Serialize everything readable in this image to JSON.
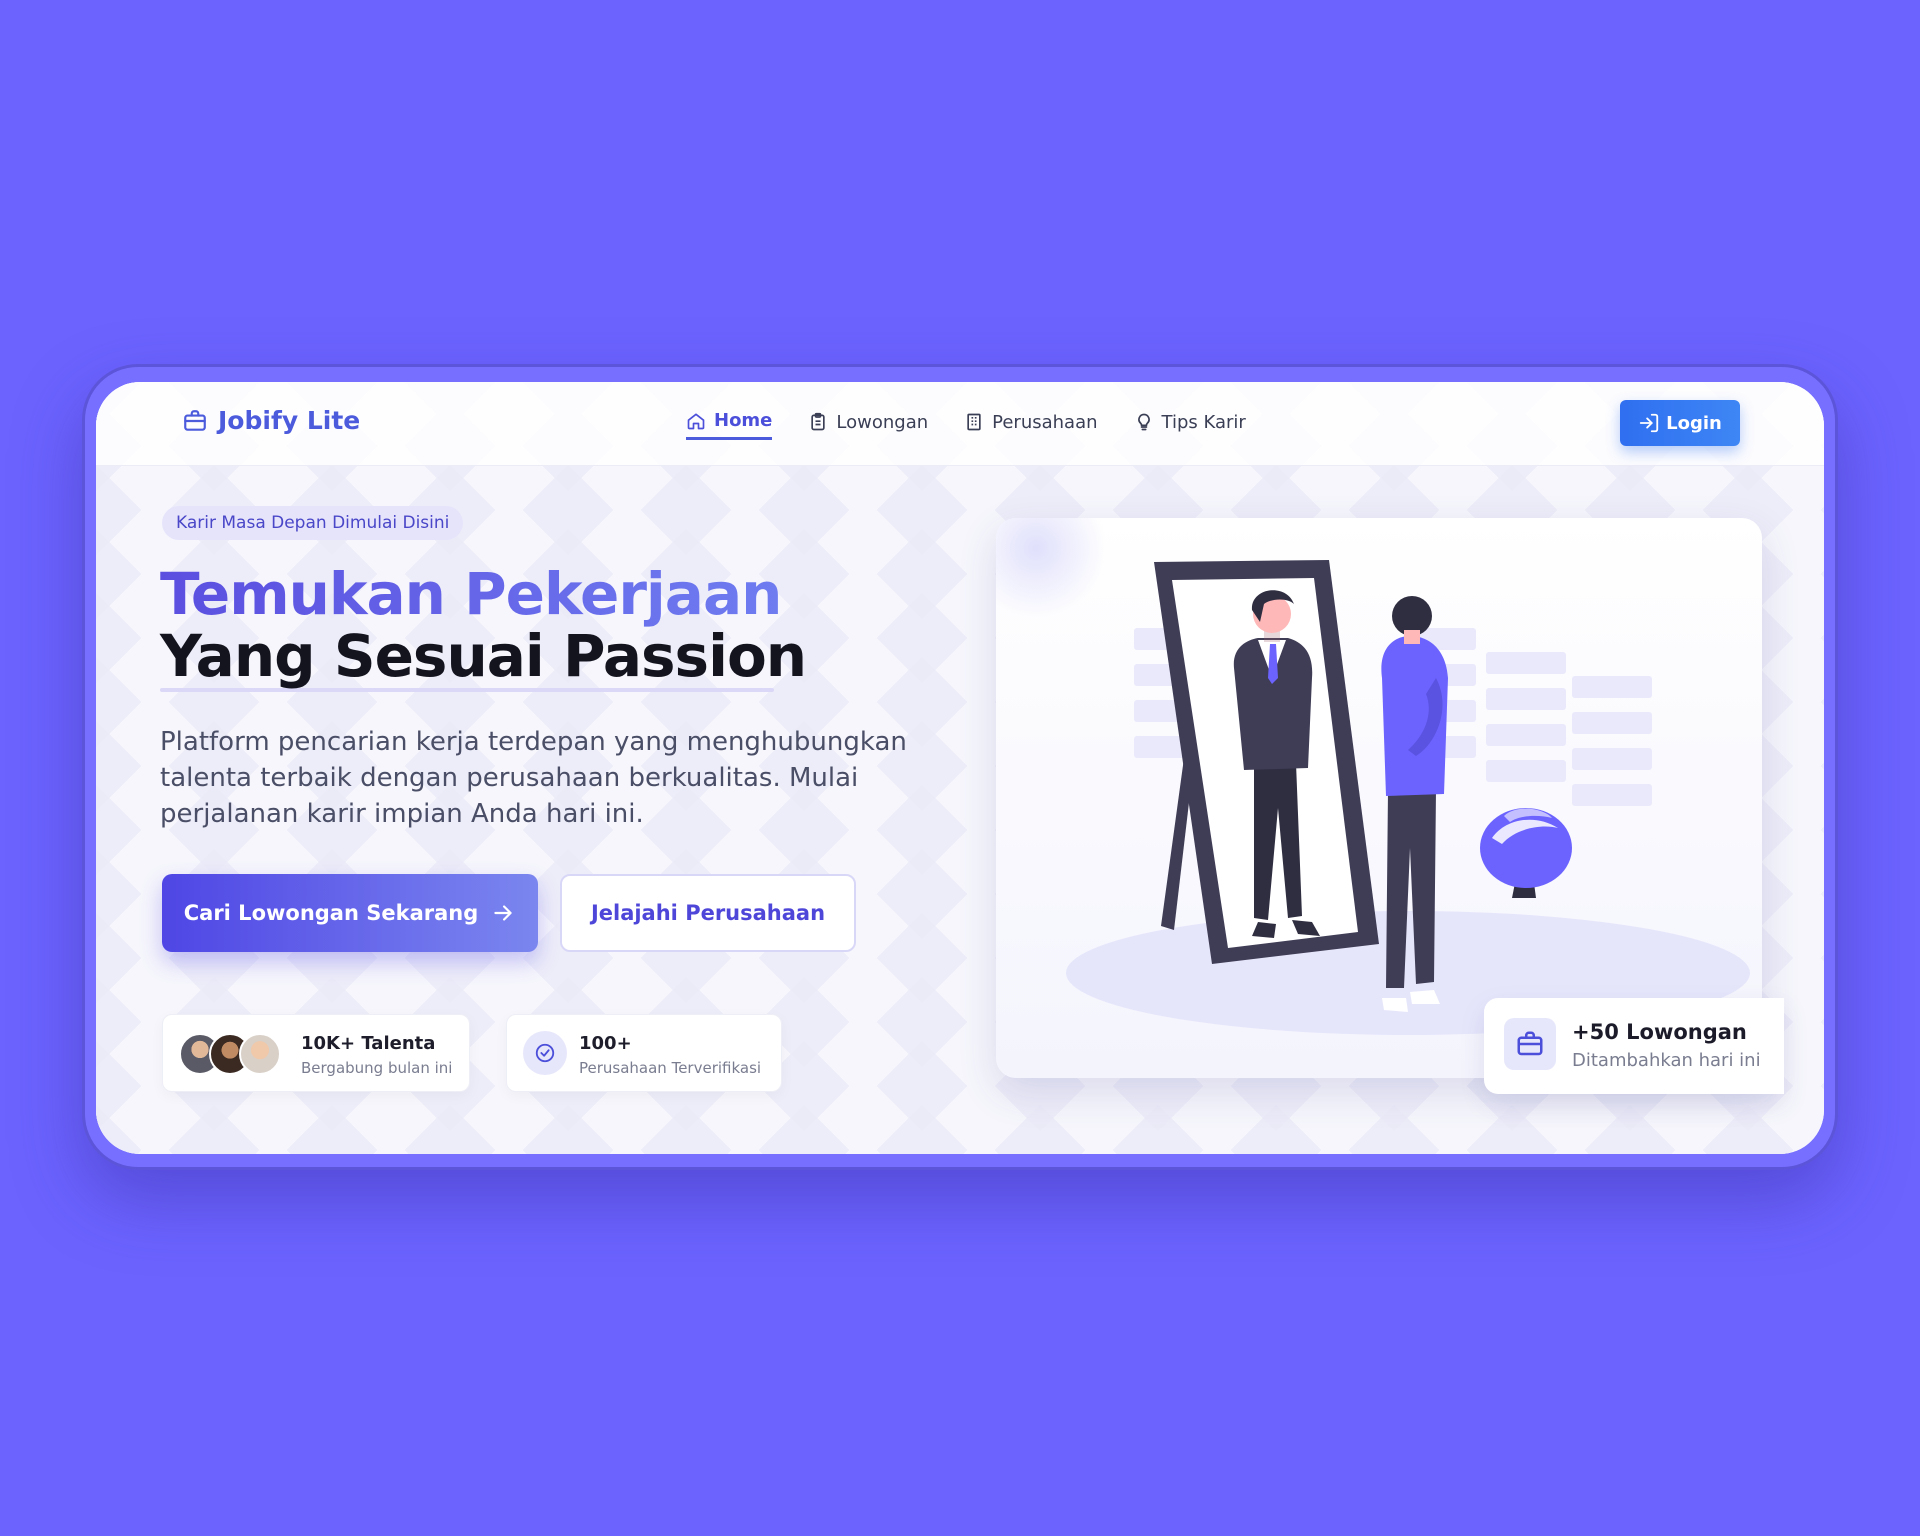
{
  "brand": {
    "name": "Jobify Lite"
  },
  "nav": {
    "items": [
      {
        "label": "Home",
        "icon": "home-icon",
        "active": true
      },
      {
        "label": "Lowongan",
        "icon": "clipboard-icon"
      },
      {
        "label": "Perusahaan",
        "icon": "building-icon"
      },
      {
        "label": "Tips Karir",
        "icon": "lightbulb-icon"
      }
    ],
    "login_label": "Login"
  },
  "hero": {
    "tagline": "Karir Masa Depan Dimulai Disini",
    "title_line1": "Temukan Pekerjaan",
    "title_line2": "Yang Sesuai Passion",
    "description": "Platform pencarian kerja terdepan yang menghubungkan talenta terbaik dengan perusahaan berkualitas. Mulai perjalanan karir impian Anda hari ini.",
    "primary_button": "Cari Lowongan Sekarang",
    "secondary_button": "Jelajahi Perusahaan"
  },
  "stats": [
    {
      "title": "10K+ Talenta",
      "subtitle": "Bergabung bulan ini"
    },
    {
      "title": "100+",
      "subtitle": "Perusahaan Terverifikasi"
    }
  ],
  "jobs_badge": {
    "title": "+50 Lowongan",
    "subtitle": "Ditambahkan hari ini"
  },
  "colors": {
    "page_bg": "#6c63ff",
    "accent": "#4f46e5",
    "login": "#2f6ff0"
  }
}
